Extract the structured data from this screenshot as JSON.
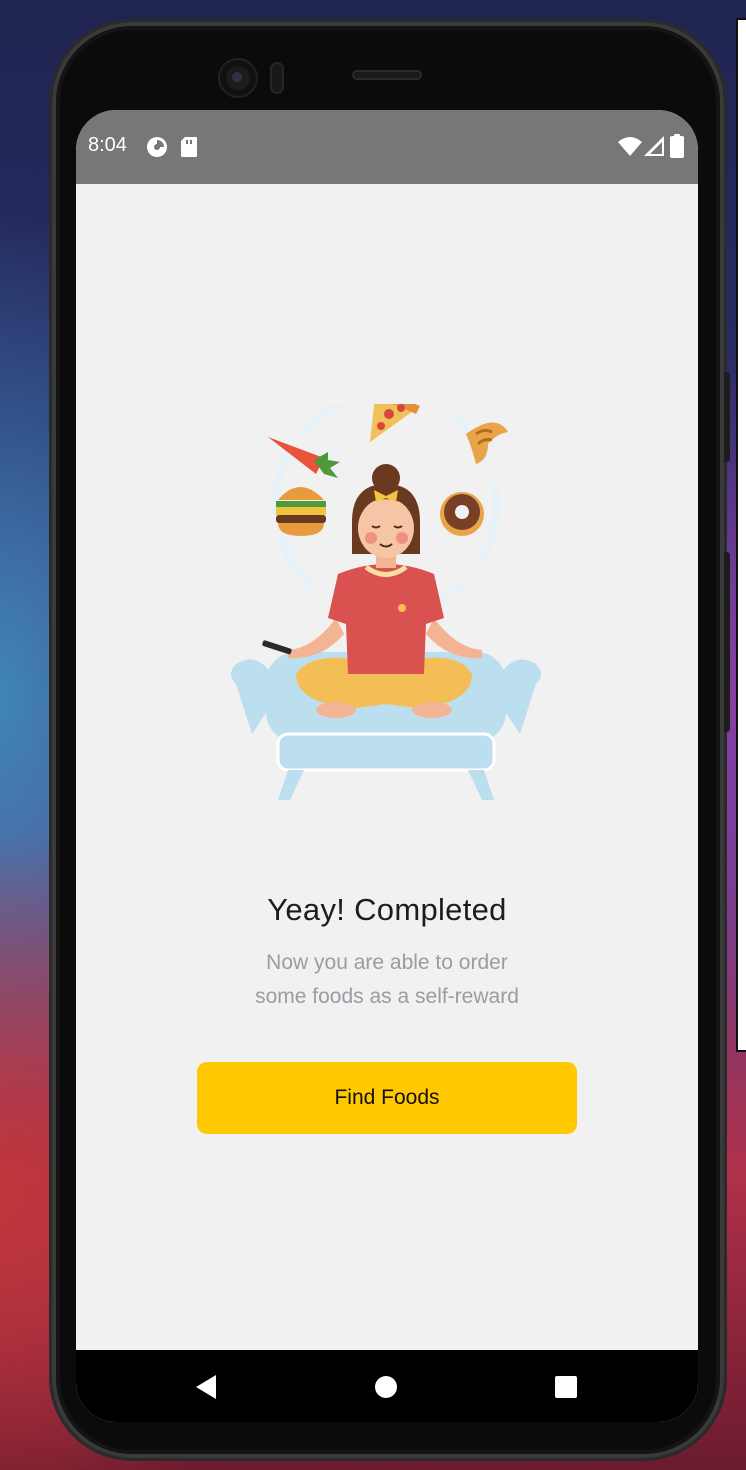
{
  "status_bar": {
    "time": "8:04",
    "left_icons": [
      "data-saver-icon",
      "sd-card-icon"
    ],
    "right_icons": [
      "wifi-icon",
      "signal-icon",
      "battery-icon"
    ]
  },
  "screen": {
    "title": "Yeay! Completed",
    "subtitle_line1": "Now you are able to order",
    "subtitle_line2": "some foods as a self-reward",
    "cta_label": "Find Foods",
    "illustration_icon": "meditating-woman-food-illustration"
  },
  "nav_bar": {
    "buttons": [
      "back-icon",
      "home-icon",
      "recents-icon"
    ]
  },
  "colors": {
    "accent": "#ffc800",
    "background": "#f1f1f1",
    "status_bar": "#777777",
    "title": "#1d1d1f",
    "subtitle": "#9b9ca3"
  }
}
